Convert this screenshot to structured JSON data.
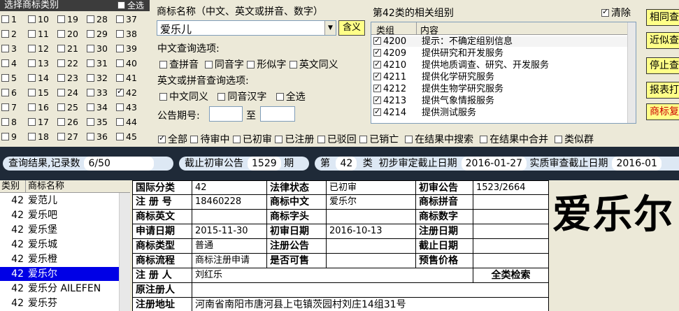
{
  "category_panel": {
    "title": "选择商标类别",
    "select_all": "全选",
    "columns": [
      [
        "1",
        "2",
        "3",
        "4",
        "5",
        "6",
        "7",
        "8",
        "9"
      ],
      [
        "10",
        "11",
        "12",
        "13",
        "14",
        "15",
        "16",
        "17",
        "18"
      ],
      [
        "19",
        "20",
        "21",
        "22",
        "23",
        "24",
        "25",
        "26",
        "27"
      ],
      [
        "28",
        "29",
        "30",
        "31",
        "32",
        "33",
        "34",
        "35",
        "36"
      ],
      [
        "37",
        "38",
        "39",
        "40",
        "41",
        "42",
        "43",
        "44",
        "45"
      ]
    ],
    "checked": [
      "42"
    ]
  },
  "query": {
    "name_label": "商标名称（中文、英文或拼音、数字）",
    "name_value": "爱乐儿",
    "contains_button": "含义",
    "cn_options_label": "中文查询选项:",
    "cn_options": [
      "查拼音",
      "同音字",
      "形似字",
      "英文同义"
    ],
    "en_options_label": "英文或拼音查询选项:",
    "en_options": [
      "中文同义",
      "同音汉字",
      "全选"
    ],
    "gazette_label": "公告期号:",
    "to_label": "至",
    "status_filters": [
      "全部",
      "待审中",
      "已初审",
      "已注册",
      "已驳回",
      "已销亡"
    ],
    "result_filters": [
      "在结果中搜索",
      "在结果中合并",
      "类似群"
    ]
  },
  "groups": {
    "title": "第42类的相关组别",
    "clear_label": "清除",
    "headers": [
      "类组",
      "内容"
    ],
    "rows": [
      {
        "code": "4200",
        "content": "提示：不确定组别信息"
      },
      {
        "code": "4209",
        "content": "提供研究和开发服务"
      },
      {
        "code": "4210",
        "content": "提供地质调查、研究、开发服务"
      },
      {
        "code": "4211",
        "content": "提供化学研究服务"
      },
      {
        "code": "4212",
        "content": "提供生物学研究服务"
      },
      {
        "code": "4213",
        "content": "提供气象情报服务"
      },
      {
        "code": "4214",
        "content": "提供测试服务"
      }
    ]
  },
  "side_buttons": [
    "相同查询",
    "近似查询",
    "停止查询",
    "报表打印",
    "商标复制"
  ],
  "info_bar": {
    "result_label": "查询结果,记录数",
    "result_count": "6/50",
    "deadline_label": "截止初审公告",
    "deadline_value": "1529",
    "deadline_unit": "期",
    "class_prefix": "第",
    "class_value": "42",
    "class_suffix": "类",
    "prelim_label": "初步审定截止日期",
    "prelim_date": "2016-01-27",
    "substantive_label": "实质审查截止日期",
    "substantive_date": "2016-01"
  },
  "results": {
    "headers": [
      "类别",
      "商标名称"
    ],
    "rows": [
      {
        "cls": "42",
        "name": "爱范儿"
      },
      {
        "cls": "42",
        "name": "爱乐吧"
      },
      {
        "cls": "42",
        "name": "爱乐堡"
      },
      {
        "cls": "42",
        "name": "爱乐城"
      },
      {
        "cls": "42",
        "name": "爱乐橙"
      },
      {
        "cls": "42",
        "name": "爱乐尔"
      },
      {
        "cls": "42",
        "name": "爱乐分 AILEFEN"
      },
      {
        "cls": "42",
        "name": "爱乐芬"
      }
    ],
    "selected": 5
  },
  "detail": {
    "intl_class_label": "国际分类",
    "intl_class": "42",
    "legal_status_label": "法律状态",
    "legal_status": "已初审",
    "prelim_gazette_label": "初审公告",
    "prelim_gazette": "1523/2664",
    "reg_no_label": "注 册 号",
    "reg_no": "18460228",
    "cn_name_label": "商标中文",
    "cn_name": "爱乐尔",
    "pinyin_label": "商标拼音",
    "pinyin": "",
    "en_name_label": "商标英文",
    "en_name": "",
    "letters_label": "商标字头",
    "letters": "",
    "digits_label": "商标数字",
    "digits": "",
    "apply_date_label": "申请日期",
    "apply_date": "2015-11-30",
    "prelim_date_label": "初审日期",
    "prelim_date": "2016-10-13",
    "reg_date_label": "注册日期",
    "reg_date": "",
    "type_label": "商标类型",
    "type": "普通",
    "reg_gazette_label": "注册公告",
    "reg_gazette": "",
    "expire_label": "截止日期",
    "expire": "",
    "process_label": "商标流程",
    "process": "商标注册申请",
    "for_sale_label": "是否可售",
    "for_sale": "",
    "presale_label": "预售价格",
    "presale": "",
    "registrant_label": "注 册 人",
    "registrant": "刘红乐",
    "all_class_label": "全类检索",
    "orig_registrant_label": "原注册人",
    "orig_registrant": "",
    "address_label": "注册地址",
    "address": "河南省南阳市唐河县上屯镇茨园村刘庄14组31号"
  },
  "preview_name": "爱乐尔"
}
